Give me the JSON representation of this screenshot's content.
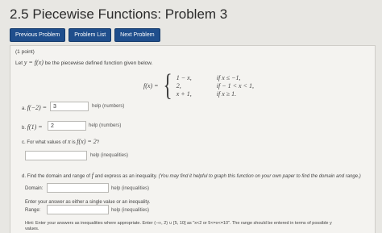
{
  "header": {
    "title": "2.5 Piecewise Functions: Problem 3"
  },
  "nav": {
    "previous": "Previous Problem",
    "list": "Problem List",
    "next": "Next Problem"
  },
  "problem": {
    "points": "(1 point)",
    "intro_let": "Let",
    "intro_eq": "y = f(x)",
    "intro_rest": "be the piecewise defined function given below.",
    "fx_lhs": "f(x) =",
    "cases": [
      {
        "expr": "1 − x,",
        "cond": "if x ≤ −1,"
      },
      {
        "expr": "2,",
        "cond": "if − 1 < x < 1,"
      },
      {
        "expr": "x + 1,",
        "cond": "if x ≥ 1."
      }
    ]
  },
  "part_a": {
    "label": "a.",
    "expr": "f(−2) =",
    "value": "3",
    "help": "help (numbers)"
  },
  "part_b": {
    "label": "b.",
    "expr": "f(1) =",
    "value": "2",
    "help": "help (numbers)"
  },
  "part_c": {
    "label": "c. For what values of",
    "var": "x",
    "mid": "is",
    "expr": "f(x) = 2",
    "q": "?",
    "value": "",
    "help": "help (inequalities)"
  },
  "part_d": {
    "text_a": "d. Find the domain and range of",
    "fn": "f",
    "text_b": "and express as an inequality.",
    "text_italic": "(You may find it helpful to graph this function on your own paper to find the domain and range.)",
    "domain_label": "Domain:",
    "domain_value": "",
    "domain_help": "help (inequalities)",
    "note": "Enter your answer as either a single value or an inequality.",
    "range_label": "Range:",
    "range_value": "",
    "range_help": "help (inequalities)",
    "hint": "Hint: Enter your answers as inequalities where appropriate. Enter (−∞, 2) ∪ [5, 10] as \"x<2 or 5<=x<=10\". The range should be entered in terms of possible y",
    "hint2": "values."
  },
  "colors": {
    "nav_button": "#1f4e8c",
    "page_bg": "#e8e7e3",
    "panel_bg": "#f4f3f0"
  }
}
